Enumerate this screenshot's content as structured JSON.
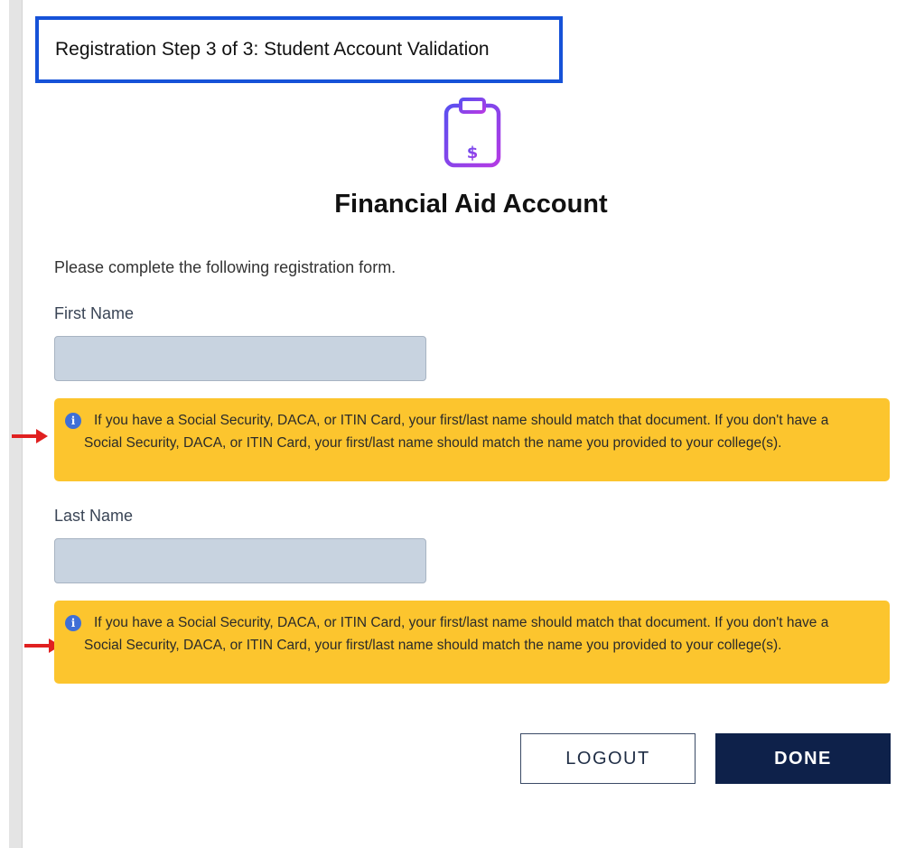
{
  "header": {
    "step_title": "Registration Step 3 of 3: Student Account Validation"
  },
  "main": {
    "icon": "clipboard-dollar-icon",
    "title": "Financial Aid Account",
    "intro": "Please complete the following registration form."
  },
  "form": {
    "first_name": {
      "label": "First Name",
      "value": "",
      "notice": "If you have a Social Security, DACA, or ITIN Card, your first/last name should match that document. If you don't have a Social Security, DACA, or ITIN Card, your first/last name should match the name you provided to your college(s)."
    },
    "last_name": {
      "label": "Last Name",
      "value": "",
      "notice": "If you have a Social Security, DACA, or ITIN Card, your first/last name should match that document. If you don't have a Social Security, DACA, or ITIN Card, your first/last name should match the name you provided to your college(s)."
    }
  },
  "actions": {
    "logout_label": "LOGOUT",
    "done_label": "DONE"
  },
  "colors": {
    "highlight_box": "#1652d8",
    "notice_background": "#fcc52e",
    "icon_gradient_start": "#6a4cf0",
    "icon_gradient_end": "#b03ce6",
    "done_button": "#0e214a",
    "annotation_arrow": "#e02020"
  }
}
